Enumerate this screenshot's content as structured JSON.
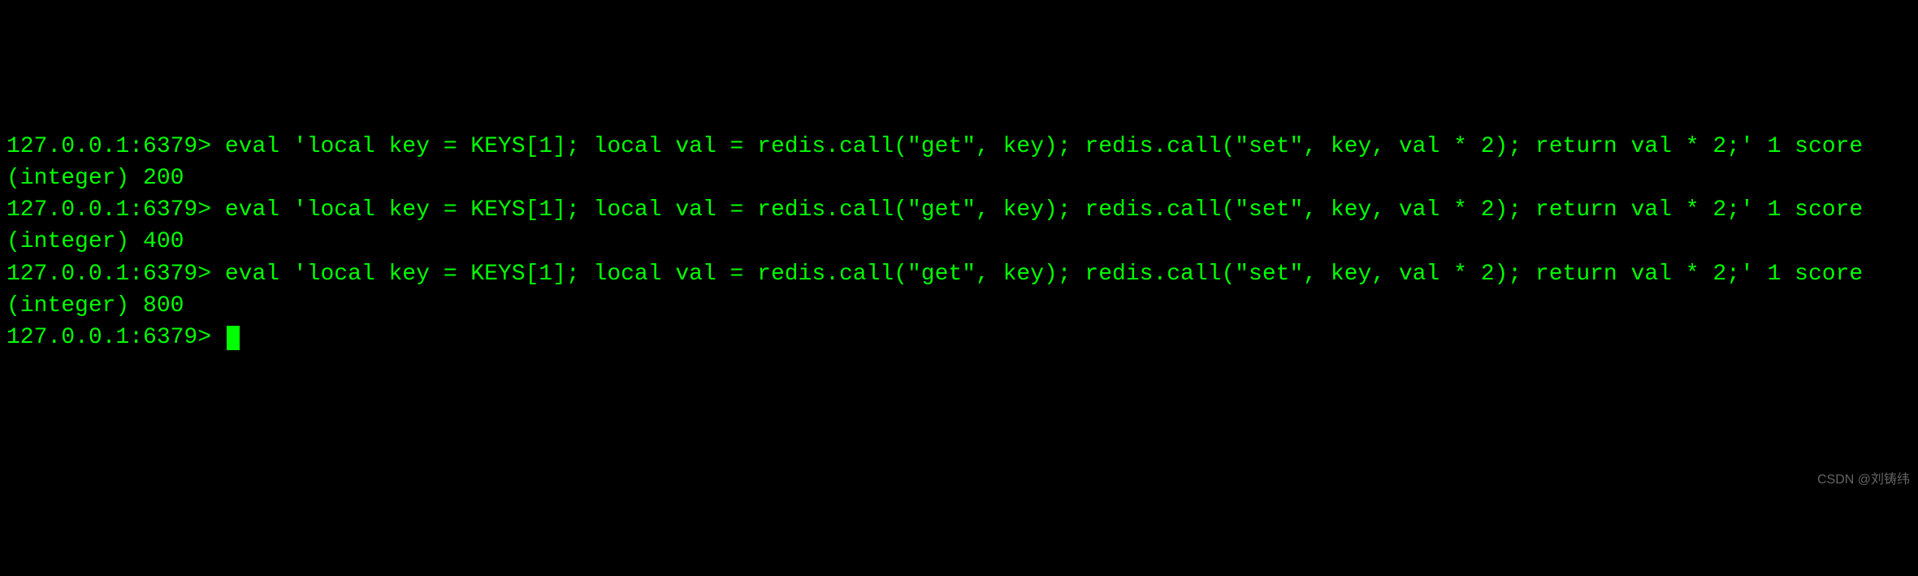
{
  "terminal": {
    "entries": [
      {
        "prompt": "127.0.0.1:6379> ",
        "command": "eval 'local key = KEYS[1]; local val = redis.call(\"get\", key); redis.call(\"set\", key, val * 2); return val * 2;' 1 score",
        "output": "(integer) 200"
      },
      {
        "prompt": "127.0.0.1:6379> ",
        "command": "eval 'local key = KEYS[1]; local val = redis.call(\"get\", key); redis.call(\"set\", key, val * 2); return val * 2;' 1 score",
        "output": "(integer) 400"
      },
      {
        "prompt": "127.0.0.1:6379> ",
        "command": "eval 'local key = KEYS[1]; local val = redis.call(\"get\", key); redis.call(\"set\", key, val * 2); return val * 2;' 1 score",
        "output": "(integer) 800"
      }
    ],
    "current_prompt": "127.0.0.1:6379> "
  },
  "watermark": "CSDN @刘铸纬"
}
